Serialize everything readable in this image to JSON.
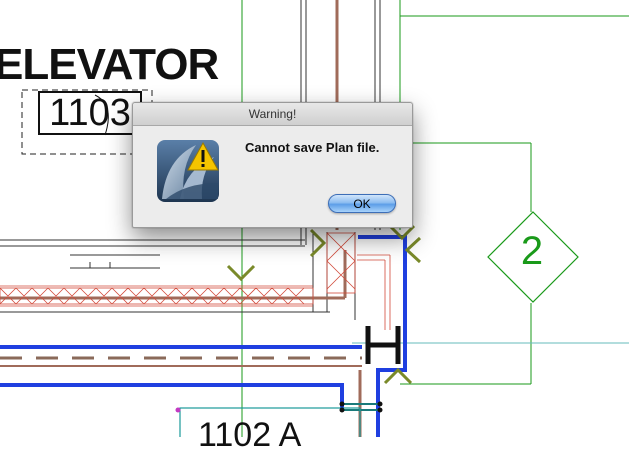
{
  "drawing": {
    "room_name": "ELEVATOR",
    "room_number": "1103",
    "grid_bubble": "2",
    "room_number_bottom": "1102 A"
  },
  "dialog": {
    "title": "Warning!",
    "message": "Cannot save Plan file.",
    "ok_label": "OK",
    "icons": [
      "app-icon",
      "warning-icon"
    ]
  },
  "colors": {
    "grid_line": "#1a9a1a",
    "wall_blue": "#1f3fe0",
    "wall_brown": "#a06b5a",
    "hatch_red": "#d24a3a",
    "marker_olive": "#7a8a2a",
    "dialog_bg": "#ececec",
    "ok_button": "#7ab4ef"
  }
}
